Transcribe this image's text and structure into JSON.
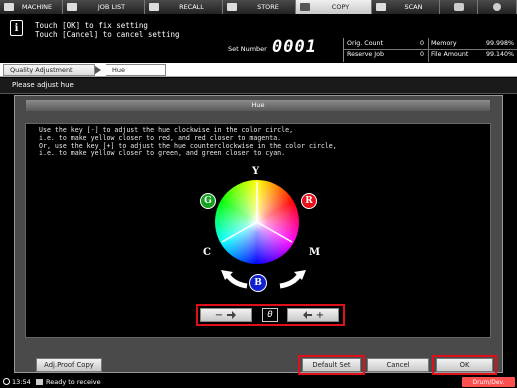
{
  "tabs": [
    {
      "label": "MACHINE",
      "icon": "machine-icon"
    },
    {
      "label": "JOB LIST",
      "icon": "job-list-icon"
    },
    {
      "label": "RECALL",
      "icon": "recall-icon"
    },
    {
      "label": "STORE",
      "icon": "store-icon"
    },
    {
      "label": "COPY",
      "icon": "copy-icon",
      "active": true
    },
    {
      "label": "SCAN",
      "icon": "scan-icon"
    }
  ],
  "utility_icons": [
    "settings-icon",
    "help-icon"
  ],
  "info": {
    "line1": "Touch [OK] to fix setting",
    "line2": "Touch [Cancel] to cancel setting",
    "set_number_label": "Set Number",
    "set_number": "0001"
  },
  "stats": {
    "orig_count_label": "Orig. Count",
    "orig_count": "0",
    "memory_label": "Memory",
    "memory": "99.998%",
    "reserve_job_label": "Reserve Job",
    "reserve_job": "0",
    "file_amount_label": "File Amount",
    "file_amount": "99.140%"
  },
  "breadcrumb": {
    "parent": "Quality Adjustment",
    "current": "Hue"
  },
  "prompt": "Please adjust hue",
  "panel": {
    "title": "Hue",
    "description": "Use the key [-] to adjust the hue clockwise in the color circle,\ni.e. to make yellow closer to red, and red closer to magenta.\nOr, use the key [+] to adjust the hue counterclockwise in the color circle,\ni.e. to make yellow closer to green, and green closer to cyan.",
    "wheel_labels": {
      "y": "Y",
      "r": "R",
      "g": "G",
      "c": "C",
      "m": "M",
      "b": "B"
    },
    "stepper": {
      "minus_label": "−",
      "plus_label": "+",
      "value": "0"
    }
  },
  "buttons": {
    "adj_proof_copy": "Adj.Proof Copy",
    "default_set": "Default Set",
    "cancel": "Cancel",
    "ok": "OK"
  },
  "status": {
    "time": "13:54",
    "message": "Ready to receive",
    "drum": "Drum/Dev."
  },
  "colors": {
    "highlight": "#e0101a",
    "red_dot": "#e8101a",
    "green_dot": "#12a020",
    "blue_dot": "#1020d0"
  }
}
